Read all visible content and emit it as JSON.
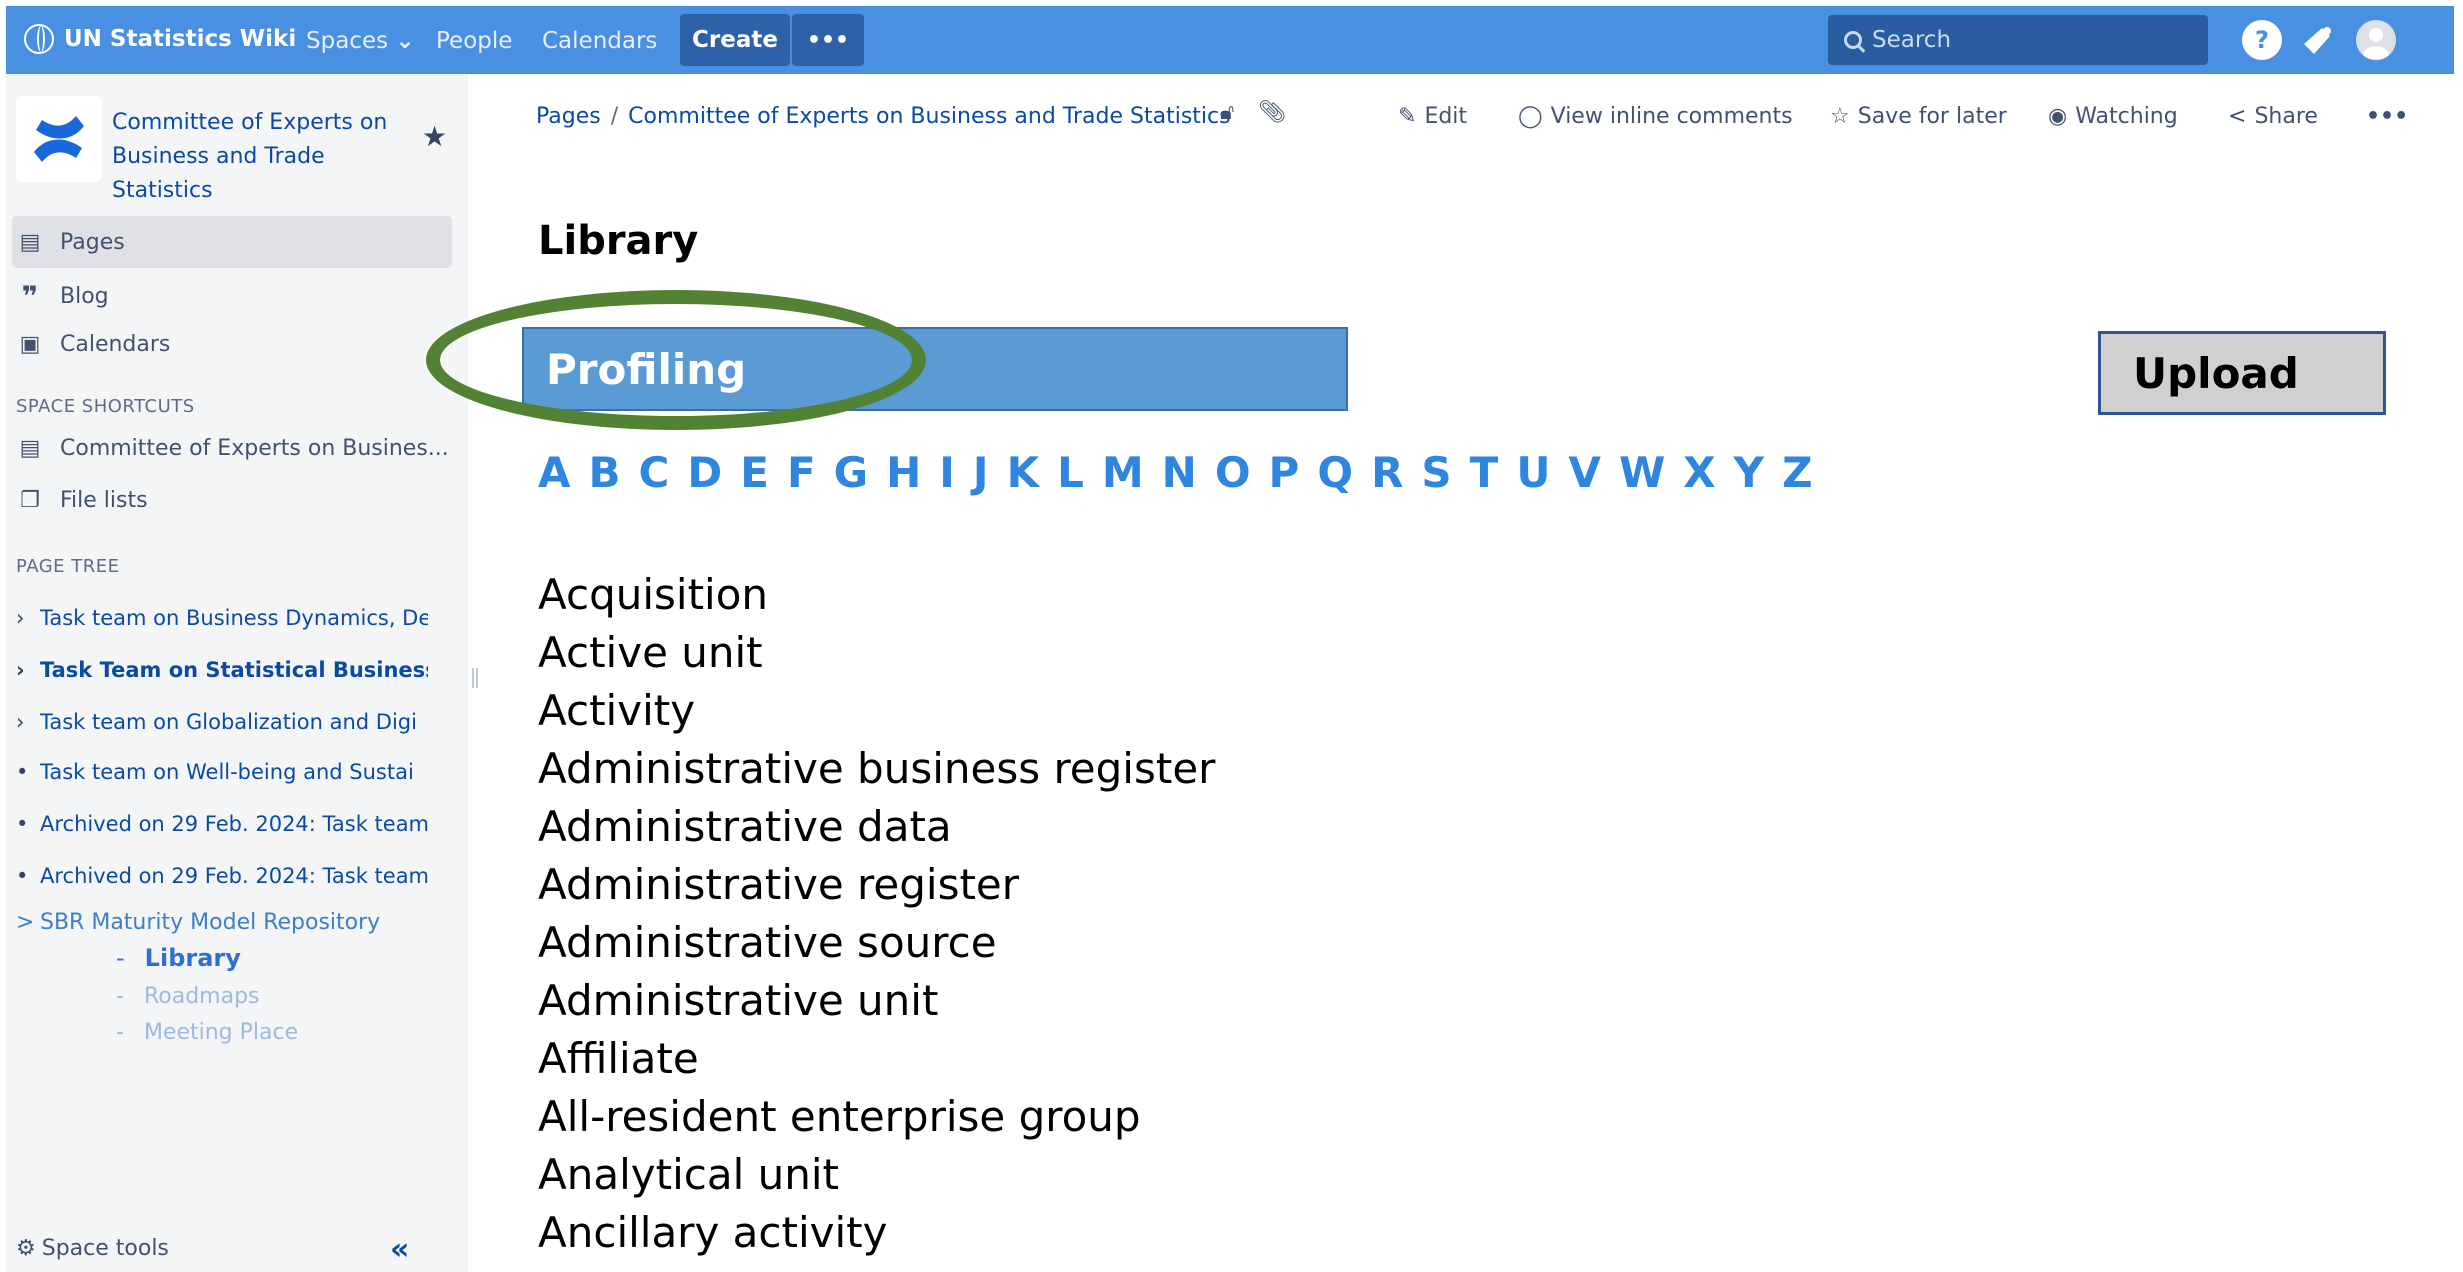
{
  "topbar": {
    "app_name": "UN Statistics Wiki",
    "nav": [
      "Spaces",
      "People",
      "Calendars"
    ],
    "spaces_chevron": "⌄",
    "create_label": "Create",
    "more_label": "•••",
    "search_placeholder": "Search",
    "help_icon": "?",
    "brand_color": "#4a90e2"
  },
  "sidebar": {
    "space_title": "Committee of Experts on Business and Trade Statistics",
    "nav": [
      {
        "label": "Pages",
        "icon": "page-icon"
      },
      {
        "label": "Blog",
        "icon": "quote-icon"
      },
      {
        "label": "Calendars",
        "icon": "calendar-icon"
      }
    ],
    "shortcuts_heading": "SPACE SHORTCUTS",
    "shortcuts": [
      {
        "label": "Committee of Experts on Busines...",
        "icon": "page-icon"
      },
      {
        "label": "File lists",
        "icon": "copy-icon"
      }
    ],
    "tree_heading": "PAGE TREE",
    "tree": [
      {
        "label": "Task team on Business Dynamics, De",
        "bullet": "›"
      },
      {
        "label": "Task Team on Statistical Business I",
        "bullet": "›"
      },
      {
        "label": "Task team on Globalization and Digi",
        "bullet": "›"
      },
      {
        "label": "Task team on Well-being and Sustai",
        "bullet": "•"
      },
      {
        "label": "Archived on 29 Feb. 2024: Task team",
        "bullet": "•"
      },
      {
        "label": "Archived on 29 Feb. 2024: Task team",
        "bullet": "•"
      }
    ],
    "repo": {
      "label": "SBR Maturity Model Repository",
      "bullet": ">"
    },
    "sub": [
      {
        "label": "Library",
        "dash": "-"
      },
      {
        "label": "Roadmaps",
        "dash": "-"
      },
      {
        "label": "Meeting Place",
        "dash": "-"
      }
    ],
    "space_tools": "Space tools",
    "collapse": "«"
  },
  "header": {
    "breadcrumbs": [
      "Pages",
      "Committee of Experts on Business and Trade Statistics"
    ],
    "separator": "/",
    "actions": {
      "edit": "Edit",
      "comments": "View inline comments",
      "save": "Save for later",
      "watching": "Watching",
      "share": "Share",
      "more": "•••"
    }
  },
  "content": {
    "title": "Library",
    "profiling": "Profiling",
    "upload": "Upload",
    "alphabet": [
      "A",
      "B",
      "C",
      "D",
      "E",
      "F",
      "G",
      "H",
      "I",
      "J",
      "K",
      "L",
      "M",
      "N",
      "O",
      "P",
      "Q",
      "R",
      "S",
      "T",
      "U",
      "V",
      "W",
      "X",
      "Y",
      "Z"
    ],
    "terms": [
      "Acquisition",
      "Active unit",
      "Activity",
      "Administrative business register",
      "Administrative data",
      "Administrative register",
      "Administrative source",
      "Administrative unit",
      "Affiliate",
      "All-resident enterprise group",
      "Analytical unit",
      "Ancillary activity"
    ]
  },
  "colors": {
    "highlight_ellipse": "#548235",
    "profiling_bar": "#5b9bd5",
    "letter_link": "#2e86de"
  }
}
